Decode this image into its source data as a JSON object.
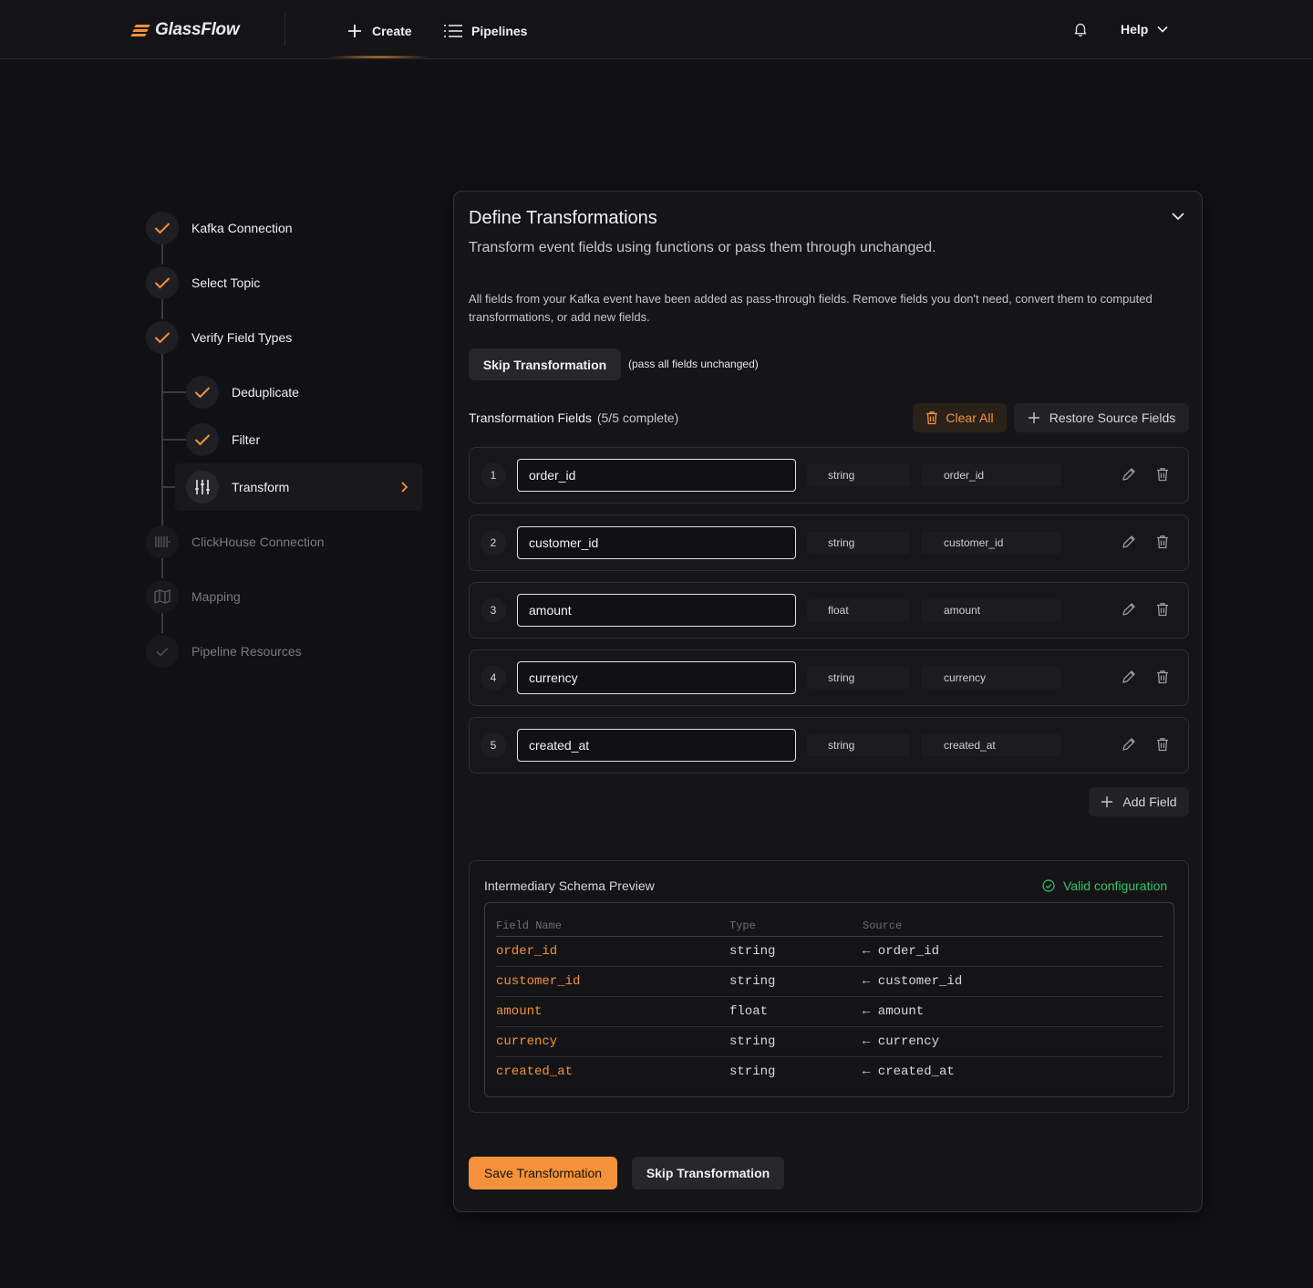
{
  "header": {
    "logo_text": "GlassFlow",
    "nav": [
      {
        "label": "Create",
        "icon": "plus-icon"
      },
      {
        "label": "Pipelines",
        "icon": "list-icon"
      }
    ],
    "help_label": "Help",
    "accent_color": "#f3923a"
  },
  "stepper": {
    "steps": [
      {
        "label": "Kafka Connection",
        "state": "done"
      },
      {
        "label": "Select Topic",
        "state": "done"
      },
      {
        "label": "Verify Field Types",
        "state": "done"
      },
      {
        "label": "Deduplicate",
        "state": "done"
      },
      {
        "label": "Filter",
        "state": "done"
      },
      {
        "label": "Transform",
        "state": "active"
      },
      {
        "label": "ClickHouse Connection",
        "state": "pending"
      },
      {
        "label": "Mapping",
        "state": "pending"
      },
      {
        "label": "Pipeline Resources",
        "state": "pending"
      }
    ]
  },
  "card": {
    "title": "Define Transformations",
    "subtitle": "Transform event fields using functions or pass them through unchanged.",
    "info": "All fields from your Kafka event have been added as pass-through fields. Remove fields you don't need, convert them to computed transformations, or add new fields.",
    "skip_label": "Skip Transformation",
    "skip_hint": "(pass all fields unchanged)",
    "fields_label": "Transformation Fields",
    "fields_count": "(5/5 complete)",
    "clear_all_label": "Clear All",
    "restore_label": "Restore Source Fields",
    "add_field_label": "Add Field",
    "fields": [
      {
        "num": "1",
        "name": "order_id",
        "type": "string",
        "source": "order_id"
      },
      {
        "num": "2",
        "name": "customer_id",
        "type": "string",
        "source": "customer_id"
      },
      {
        "num": "3",
        "name": "amount",
        "type": "float",
        "source": "amount"
      },
      {
        "num": "4",
        "name": "currency",
        "type": "string",
        "source": "currency"
      },
      {
        "num": "5",
        "name": "created_at",
        "type": "string",
        "source": "created_at"
      }
    ],
    "preview": {
      "title": "Intermediary Schema Preview",
      "status": "Valid configuration",
      "status_color": "#35c46a",
      "columns": [
        "Field Name",
        "Type",
        "Source"
      ],
      "rows": [
        {
          "name": "order_id",
          "type": "string",
          "source": "← order_id"
        },
        {
          "name": "customer_id",
          "type": "string",
          "source": "← customer_id"
        },
        {
          "name": "amount",
          "type": "float",
          "source": "← amount"
        },
        {
          "name": "currency",
          "type": "string",
          "source": "← currency"
        },
        {
          "name": "created_at",
          "type": "string",
          "source": "← created_at"
        }
      ]
    },
    "save_label": "Save Transformation",
    "skip_bottom_label": "Skip Transformation"
  }
}
